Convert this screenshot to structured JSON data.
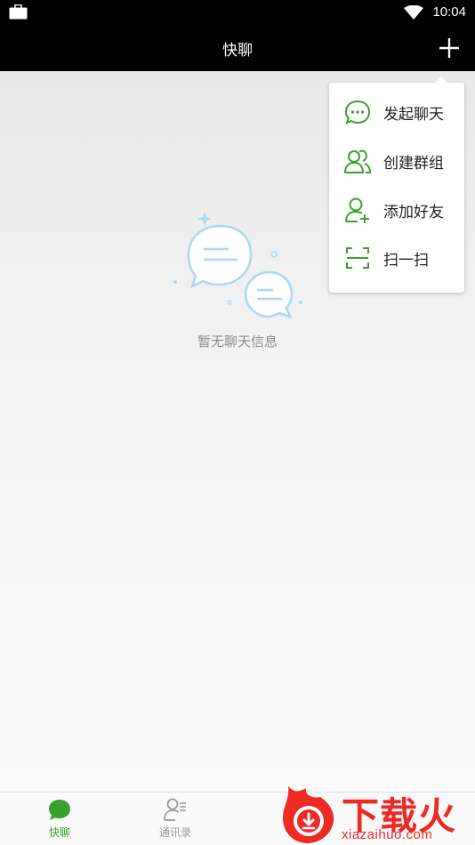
{
  "status_bar": {
    "time": "10:04"
  },
  "header": {
    "title": "快聊"
  },
  "empty_state": {
    "text": "暂无聊天信息"
  },
  "popup_menu": {
    "items": [
      {
        "label": "发起聊天",
        "icon": "chat-bubble-icon"
      },
      {
        "label": "创建群组",
        "icon": "group-icon"
      },
      {
        "label": "添加好友",
        "icon": "add-friend-icon"
      },
      {
        "label": "扫一扫",
        "icon": "scan-icon"
      }
    ]
  },
  "tab_bar": {
    "tabs": [
      {
        "label": "快聊",
        "icon": "chat-icon",
        "active": true
      },
      {
        "label": "通讯录",
        "icon": "contacts-icon",
        "active": false
      }
    ]
  },
  "watermark": {
    "main": "下载火",
    "sub": "xiazaihuo.com"
  },
  "colors": {
    "accent": "#3aa02c",
    "illustration": "#a8d8f4",
    "watermark": "#ee2a24"
  }
}
